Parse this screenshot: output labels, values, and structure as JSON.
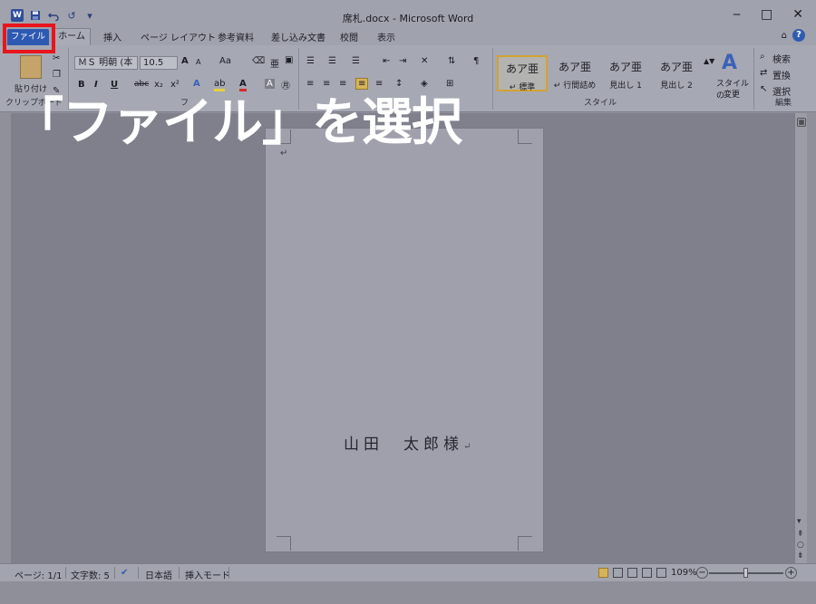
{
  "window": {
    "title": "席札.docx - Microsoft Word"
  },
  "quick_access": {
    "word_icon": "W",
    "save_icon": "save-icon",
    "undo_icon": "undo-icon",
    "redo_glyph": "↺",
    "customize_glyph": "▾"
  },
  "window_controls": {
    "minimize": "‒",
    "maximize": "□",
    "close": "✕"
  },
  "tabs": {
    "file": "ファイル",
    "home": "ホーム",
    "insert": "挿入",
    "page_layout": "ページ レイアウト",
    "references": "参考資料",
    "mailings": "差し込み文書",
    "review": "校閲",
    "view": "表示"
  },
  "help": {
    "caret": "⌂",
    "question": "?"
  },
  "ribbon": {
    "clipboard": {
      "paste_label": "貼り付け",
      "group_label": "クリップボード"
    },
    "font": {
      "name": "ＭＳ 明朝 (本",
      "size": "10.5",
      "grow": "A",
      "shrink": "A",
      "case": "Aa",
      "bold": "B",
      "italic": "I",
      "underline": "U",
      "strike": "abc",
      "subscript": "x₂",
      "superscript": "x²",
      "group_label": "フ"
    },
    "styles": {
      "items": [
        {
          "preview": "あア亜",
          "label": "↵ 標準"
        },
        {
          "preview": "あア亜",
          "label": "↵ 行間詰め"
        },
        {
          "preview": "あア亜",
          "label": "見出し 1"
        },
        {
          "preview": "あア亜",
          "label": "見出し 2"
        }
      ],
      "change_label_1": "スタイルの",
      "change_label_2": "変更",
      "group_label": "スタイル"
    },
    "editing": {
      "find": "検索",
      "replace": "置換",
      "select": "選択",
      "group_label": "編集"
    }
  },
  "caption": "「ファイル」を選択",
  "document": {
    "cursor_mark": "↵",
    "addressee": "山田　太郎様",
    "return_mark": "↵"
  },
  "statusbar": {
    "page": "ページ: 1/1",
    "words": "文字数: 5",
    "language": "日本語",
    "mode": "挿入モード",
    "zoom": "109%",
    "zoom_minus": "−",
    "zoom_plus": "+"
  }
}
